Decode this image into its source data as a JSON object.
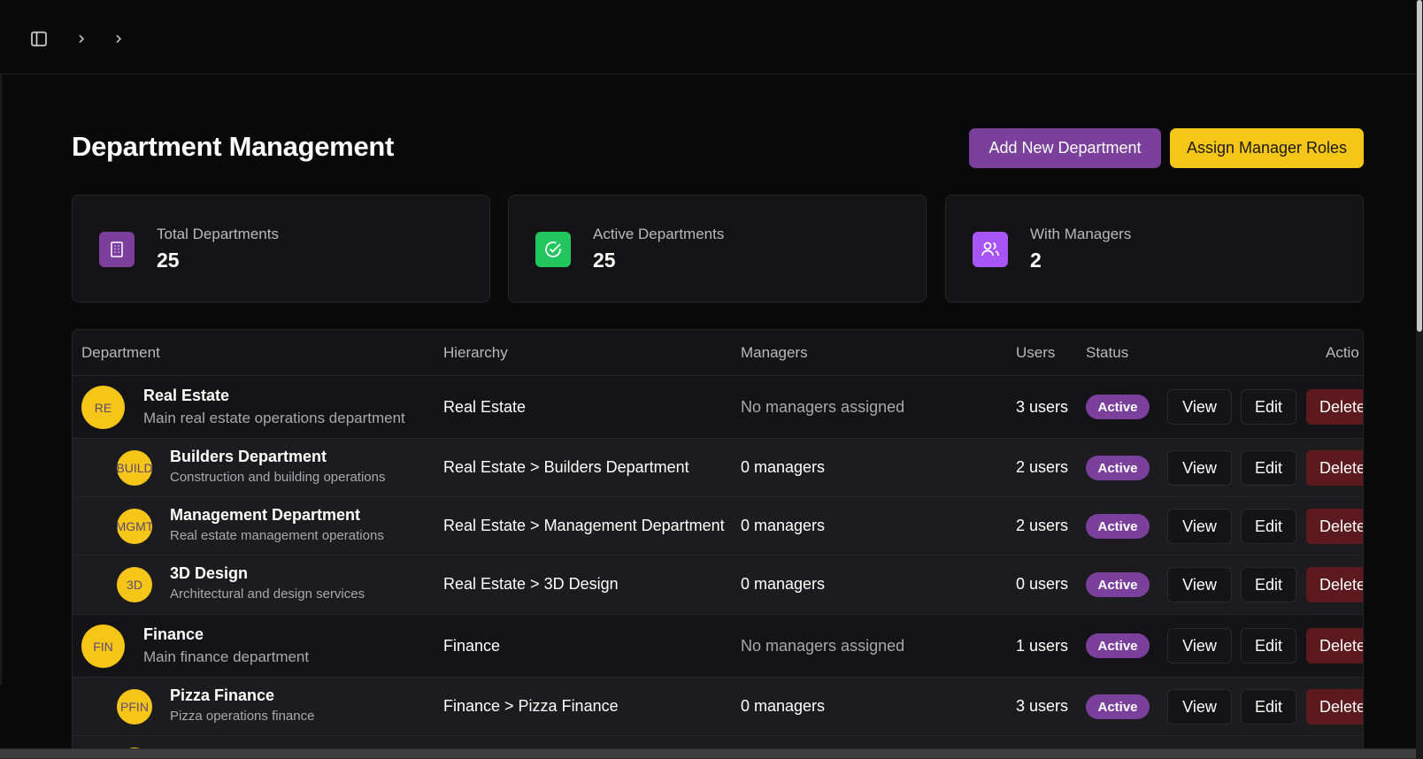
{
  "header": {
    "icons": [
      "sidebar-toggle-icon",
      "chevron-right-icon",
      "chevron-right-icon"
    ]
  },
  "page": {
    "title": "Department Management",
    "add_button": "Add New Department",
    "assign_button": "Assign Manager Roles"
  },
  "colors": {
    "accent_purple": "#7b3f9c",
    "accent_yellow": "#f5c518",
    "delete_red": "#5c1a1e",
    "green": "#22c55e",
    "violet": "#a855f7"
  },
  "stats": [
    {
      "label": "Total Departments",
      "value": "25",
      "icon": "building-icon"
    },
    {
      "label": "Active Departments",
      "value": "25",
      "icon": "check-circle-icon"
    },
    {
      "label": "With Managers",
      "value": "2",
      "icon": "users-icon"
    }
  ],
  "table": {
    "headers": {
      "department": "Department",
      "hierarchy": "Hierarchy",
      "managers": "Managers",
      "users": "Users",
      "status": "Status",
      "actions": "Actio"
    },
    "actions": {
      "view": "View",
      "edit": "Edit",
      "delete": "Delete"
    },
    "rows": [
      {
        "level": "parent",
        "initials": "RE",
        "name": "Real Estate",
        "description": "Main real estate operations department",
        "hierarchy": "Real Estate",
        "managers": "No managers assigned",
        "users": "3 users",
        "status": "Active"
      },
      {
        "level": "child",
        "initials": "BUILD",
        "name": "Builders Department",
        "description": "Construction and building operations",
        "hierarchy": "Real Estate > Builders Department",
        "managers": "0 managers",
        "users": "2 users",
        "status": "Active"
      },
      {
        "level": "child",
        "initials": "MGMT",
        "name": "Management Department",
        "description": "Real estate management operations",
        "hierarchy": "Real Estate > Management Department",
        "managers": "0 managers",
        "users": "2 users",
        "status": "Active"
      },
      {
        "level": "child",
        "initials": "3D",
        "name": "3D Design",
        "description": "Architectural and design services",
        "hierarchy": "Real Estate > 3D Design",
        "managers": "0 managers",
        "users": "0 users",
        "status": "Active"
      },
      {
        "level": "parent",
        "initials": "FIN",
        "name": "Finance",
        "description": "Main finance department",
        "hierarchy": "Finance",
        "managers": "No managers assigned",
        "users": "1 users",
        "status": "Active"
      },
      {
        "level": "child",
        "initials": "PFIN",
        "name": "Pizza Finance",
        "description": "Pizza operations finance",
        "hierarchy": "Finance > Pizza Finance",
        "managers": "0 managers",
        "users": "3 users",
        "status": "Active"
      }
    ]
  }
}
